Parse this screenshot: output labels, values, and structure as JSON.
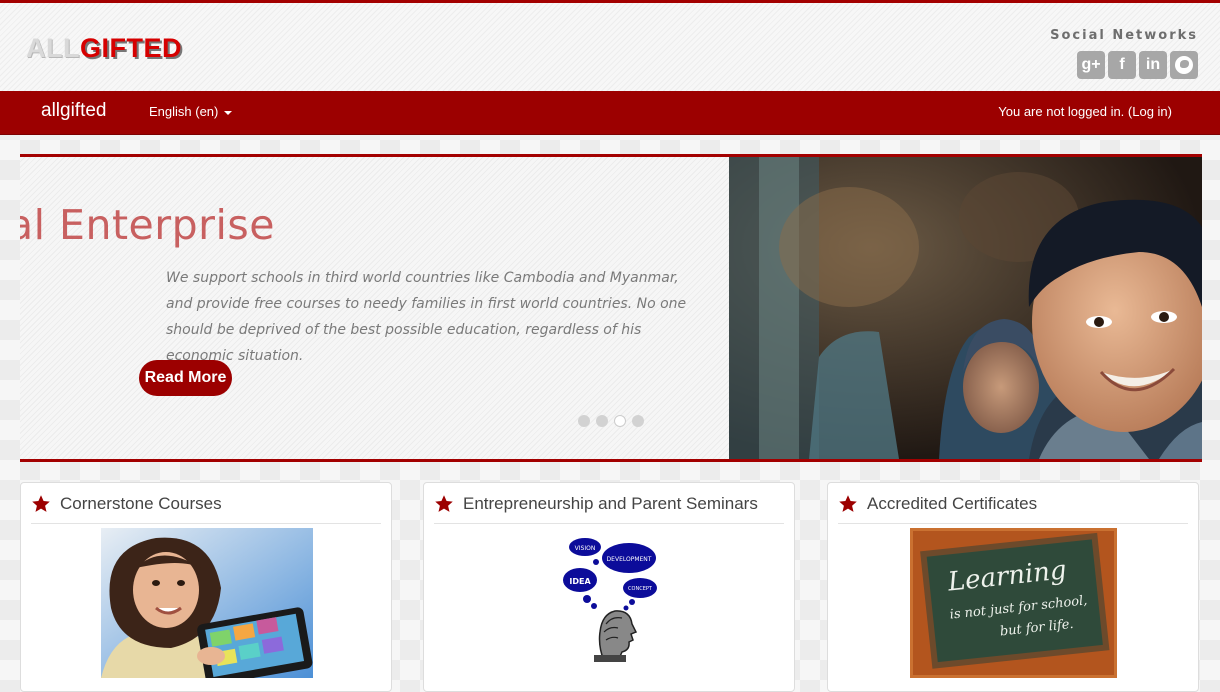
{
  "header": {
    "logo": {
      "part1": "ALL",
      "part2": "GIFTED"
    },
    "social_title": "Social Networks",
    "social_icons": [
      {
        "name": "google-plus-icon",
        "glyph": "g+"
      },
      {
        "name": "facebook-icon",
        "glyph": "f"
      },
      {
        "name": "linkedin-icon",
        "glyph": "in"
      },
      {
        "name": "globe-icon",
        "glyph": ""
      }
    ]
  },
  "navbar": {
    "brand": "allgifted",
    "language": "English (en)",
    "login_status": "You are not logged in. (Log in)"
  },
  "slider": {
    "title": "al Enterprise",
    "text": "We support schools in third world countries like Cambodia and Myanmar, and provide free courses to needy families in first world countries. No one should be deprived of the best possible education, regardless of his economic situation.",
    "button_label": "Read More",
    "dots_count": 4,
    "active_dot": 3
  },
  "cards": [
    {
      "title": "Cornerstone Courses",
      "image": "girl-with-tablet"
    },
    {
      "title": "Entrepreneurship and Parent Seminars",
      "image": "thinking-head-bubbles",
      "bubbles": [
        "VISION",
        "DEVELOPMENT",
        "IDEA",
        "CONCEPT"
      ]
    },
    {
      "title": "Accredited Certificates",
      "image": "chalkboard",
      "chalkboard_lines": [
        "Learning",
        "is not just for school,",
        "but for life."
      ]
    }
  ],
  "colors": {
    "brand_red": "#9c0000",
    "accent_red": "#d60000",
    "slide_title": "#c86060"
  }
}
